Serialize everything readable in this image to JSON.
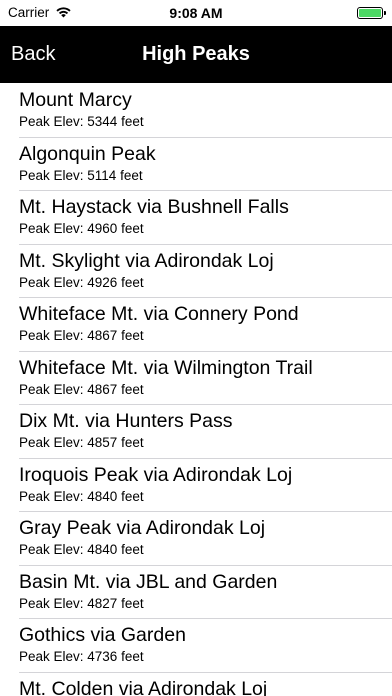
{
  "status_bar": {
    "carrier": "Carrier",
    "time": "9:08 AM",
    "battery_level": 1.0,
    "battery_color": "#4cd964"
  },
  "nav": {
    "back_label": "Back",
    "title": "High Peaks",
    "background": "#000000"
  },
  "peaks": [
    {
      "name": "Mount Marcy",
      "elevation": "Peak Elev: 5344 feet"
    },
    {
      "name": "Algonquin Peak",
      "elevation": "Peak Elev: 5114 feet"
    },
    {
      "name": "Mt. Haystack via Bushnell Falls",
      "elevation": "Peak Elev: 4960 feet"
    },
    {
      "name": "Mt. Skylight via Adirondak Loj",
      "elevation": "Peak Elev: 4926 feet"
    },
    {
      "name": "Whiteface Mt. via Connery Pond",
      "elevation": "Peak Elev: 4867 feet"
    },
    {
      "name": "Whiteface Mt. via Wilmington Trail",
      "elevation": "Peak Elev: 4867 feet"
    },
    {
      "name": "Dix Mt. via Hunters Pass",
      "elevation": "Peak Elev: 4857 feet"
    },
    {
      "name": "Iroquois Peak via Adirondak Loj",
      "elevation": "Peak Elev: 4840 feet"
    },
    {
      "name": "Gray Peak via Adirondak Loj",
      "elevation": "Peak Elev: 4840 feet"
    },
    {
      "name": "Basin Mt. via JBL and Garden",
      "elevation": "Peak Elev: 4827 feet"
    },
    {
      "name": "Gothics via Garden",
      "elevation": "Peak Elev: 4736 feet"
    },
    {
      "name": "Mt. Colden via Adirondak Loj",
      "elevation": ""
    }
  ]
}
